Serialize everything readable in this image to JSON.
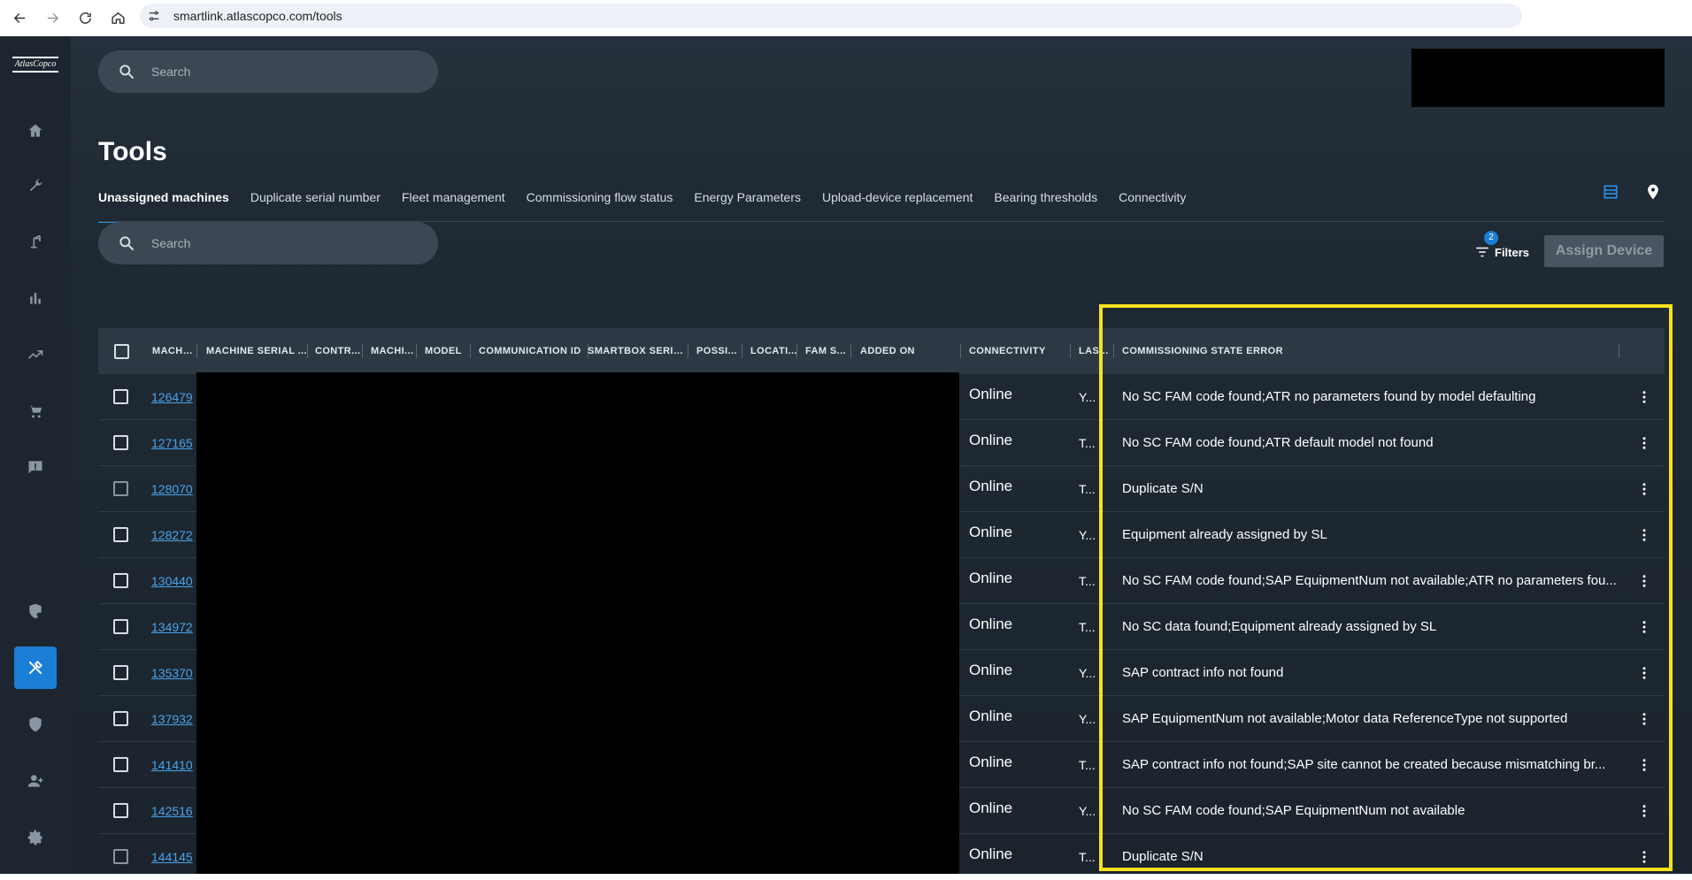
{
  "browser": {
    "url": "smartlink.atlascopco.com/tools"
  },
  "brand": {
    "logo_text": "AtlasCopco"
  },
  "top_search": {
    "placeholder": "Search"
  },
  "page": {
    "title": "Tools"
  },
  "tabs": [
    {
      "label": "Unassigned machines",
      "active": true
    },
    {
      "label": "Duplicate serial number"
    },
    {
      "label": "Fleet management"
    },
    {
      "label": "Commissioning flow status"
    },
    {
      "label": "Energy Parameters"
    },
    {
      "label": "Upload-device replacement"
    },
    {
      "label": "Bearing thresholds"
    },
    {
      "label": "Connectivity"
    }
  ],
  "table_search": {
    "placeholder": "Search"
  },
  "filters": {
    "label": "Filters",
    "count": "2"
  },
  "assign_button": {
    "label": "Assign Device"
  },
  "columns": [
    "MACHI...",
    "MACHINE SERIAL ...",
    "CONTR...",
    "MACHI...",
    "MODEL",
    "COMMUNICATION ID",
    "SMARTBOX SERIA...",
    "POSSI...",
    "LOCATI...",
    "FAM S...",
    "ADDED ON",
    "CONNECTIVITY",
    "LAS...",
    "COMMISSIONING STATE ERROR"
  ],
  "rows": [
    {
      "machine": "126479",
      "connectivity": "Online",
      "last": "Y...",
      "error": "No SC FAM code found;ATR no parameters found by model defaulting"
    },
    {
      "machine": "127165",
      "connectivity": "Online",
      "last": "T...",
      "error": "No SC FAM code found;ATR default model not found"
    },
    {
      "machine": "128070",
      "connectivity": "Online",
      "last": "T...",
      "error": "Duplicate S/N"
    },
    {
      "machine": "128272",
      "connectivity": "Online",
      "last": "Y...",
      "error": "Equipment already assigned by SL"
    },
    {
      "machine": "130440",
      "connectivity": "Online",
      "last": "T...",
      "error": "No SC FAM code found;SAP EquipmentNum not available;ATR no parameters fou..."
    },
    {
      "machine": "134972",
      "connectivity": "Online",
      "last": "T...",
      "error": "No SC data found;Equipment already assigned by SL"
    },
    {
      "machine": "135370",
      "connectivity": "Online",
      "last": "Y...",
      "error": "SAP contract info not found"
    },
    {
      "machine": "137932",
      "connectivity": "Online",
      "last": "Y...",
      "error": "SAP EquipmentNum not available;Motor data ReferenceType not supported"
    },
    {
      "machine": "141410",
      "connectivity": "Online",
      "last": "T...",
      "error": "SAP contract info not found;SAP site cannot be created because mismatching br..."
    },
    {
      "machine": "142516",
      "connectivity": "Online",
      "last": "Y...",
      "error": "No SC FAM code found;SAP EquipmentNum not available"
    },
    {
      "machine": "144145",
      "connectivity": "Online",
      "last": "T...",
      "error": "Duplicate S/N"
    }
  ],
  "colors": {
    "accent": "#1a7fd4",
    "link": "#4aa3ea",
    "highlight": "#f8e21c",
    "background": "#1b242d"
  }
}
